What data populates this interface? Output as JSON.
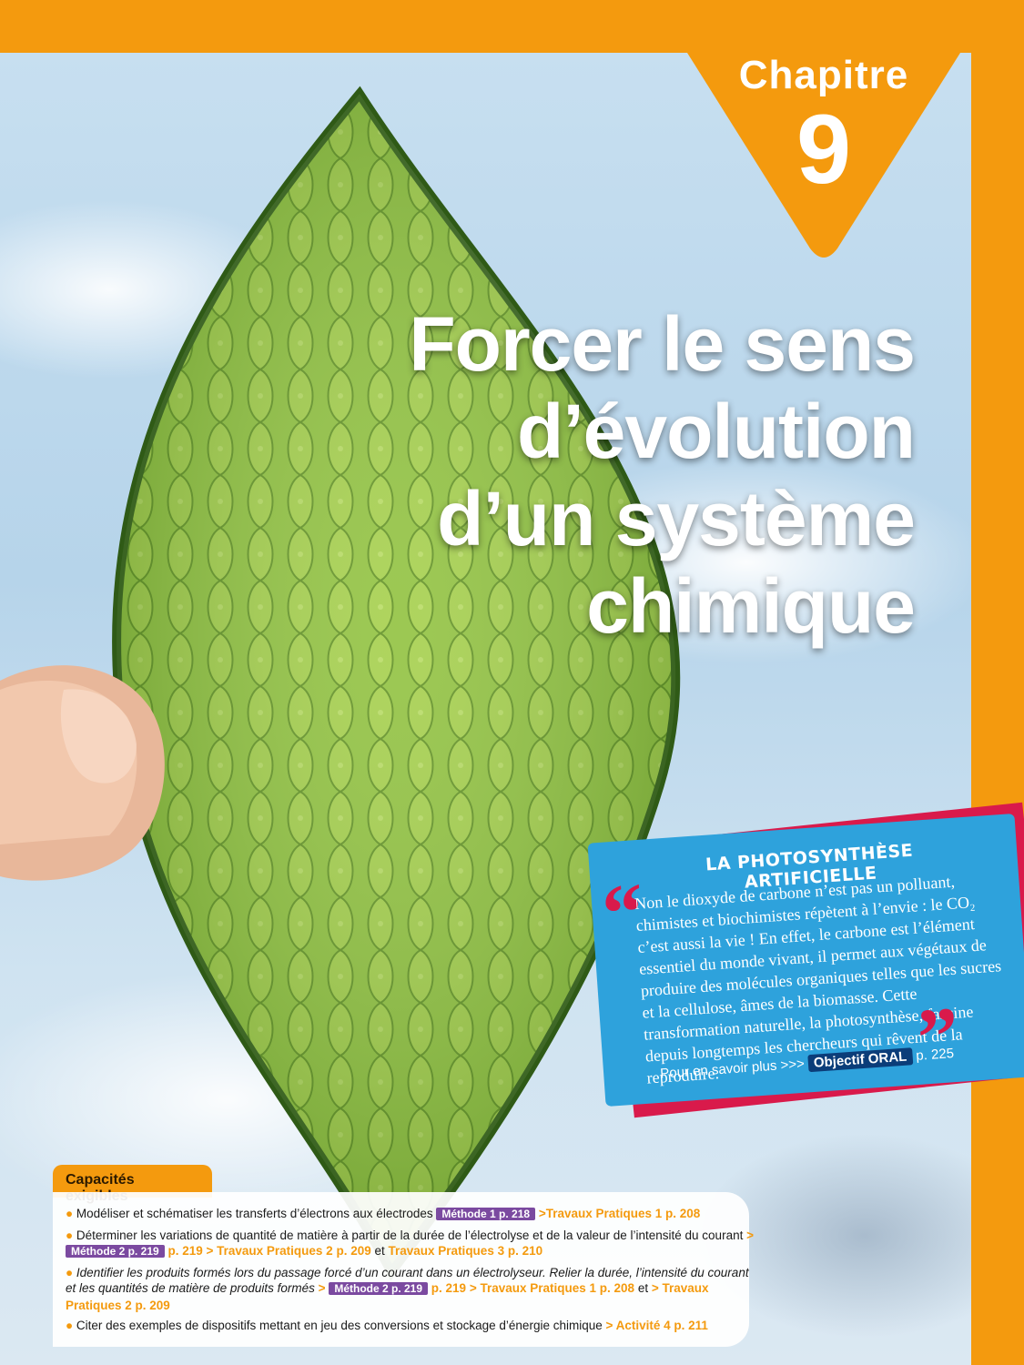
{
  "chapter": {
    "word": "Chapitre",
    "number": "9"
  },
  "title": {
    "lines": [
      "Forcer le sens",
      "d’évolution",
      "d’un système",
      "chimique"
    ]
  },
  "card": {
    "heading": "LA PHOTOSYNTHÈSE ARTIFICIELLE",
    "quote_open": "“",
    "quote_close": "”",
    "text": "Non le dioxyde de carbone n’est pas un polluant, chimistes et biochimistes répètent à l’envie : le CO₂ c’est aussi la vie ! En effet, le carbone est l’élément essentiel du monde vivant, il permet aux végétaux de produire des molécules organiques telles que les sucres et la cellulose, âmes de la biomasse. Cette transformation naturelle, la photosynthèse, fascine depuis longtemps les chercheurs qui rêvent de la reproduire.",
    "more_prefix": "Pour en savoir plus >>>",
    "more_badge": "Objectif ORAL",
    "more_page": "p. 225"
  },
  "capacites": {
    "tag": "Capacités exigibles",
    "bullet": "●",
    "items": [
      {
        "text": "Modéliser et schématiser les transferts d’électrons aux électrodes",
        "meth": "Méthode 1 p. 218",
        "links": ">Travaux Pratiques 1 p. 208"
      },
      {
        "text": "Déterminer les variations de quantité de matière à partir de la durée de l’électrolyse et de la valeur de l’intensité du courant",
        "pre": ">",
        "meth": "Méthode 2 p. 219",
        "links": "p. 219 > Travaux Pratiques 2 p. 209",
        "and": "et",
        "links2": "Travaux Pratiques 3 p. 210"
      },
      {
        "text": "Identifier les produits formés lors du passage forcé d’un courant dans un électrolyseur. Relier la durée, l’intensité du courant et les quantités de matière de produits formés",
        "pre": ">",
        "meth": "Méthode 2 p. 219",
        "links": "p. 219 > Travaux Pratiques 1 p. 208",
        "and": "et",
        "links2": "> Travaux Pratiques 2 p. 209"
      },
      {
        "text": "Citer des exemples de dispositifs mettant en jeu des conversions et stockage d’énergie chimique",
        "links": "> Activité 4 p. 211"
      }
    ]
  },
  "colors": {
    "orange": "#f49a0e",
    "blue": "#2ea2dc",
    "red": "#d91a4b",
    "purple": "#7b4aa0",
    "leaf": "#8cc63f"
  },
  "icons": {
    "photo": "leaf-photo"
  }
}
